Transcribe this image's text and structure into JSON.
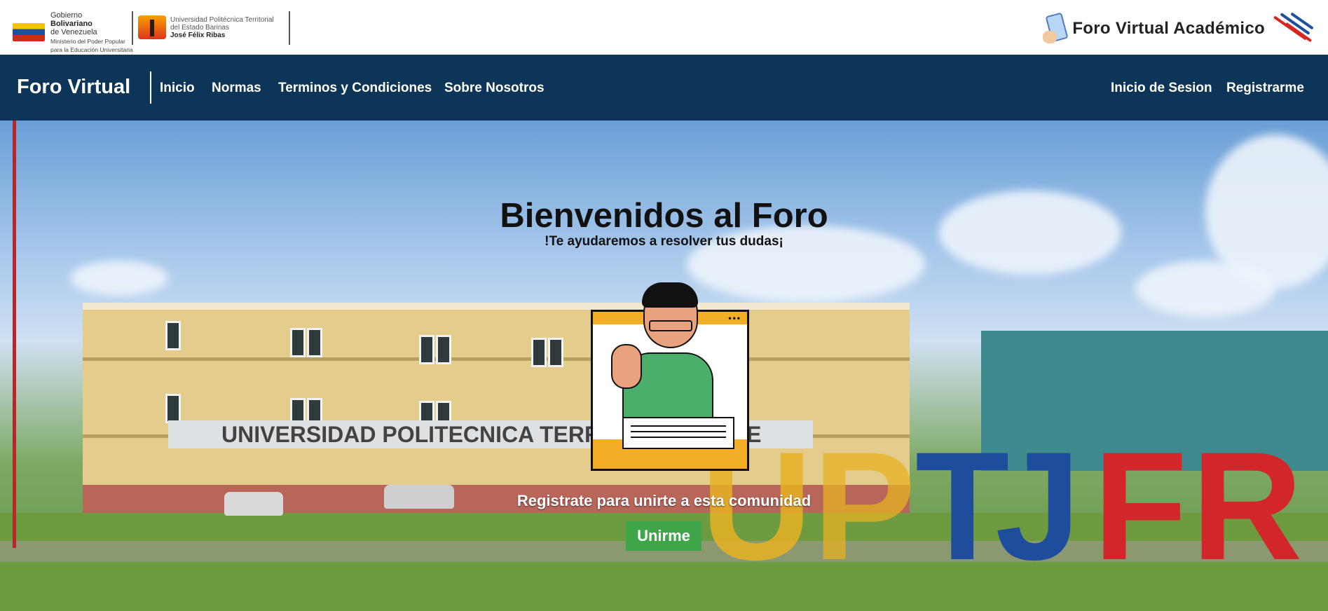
{
  "header": {
    "gov_logo": {
      "line1": "Gobierno",
      "line2": "Bolivariano",
      "line3": "de Venezuela",
      "sub1": "Ministerio del Poder Popular",
      "sub2": "para la Educación Universitaria"
    },
    "upt_logo": {
      "line1": "Universidad Politécnica Territorial",
      "line2": "del Estado Barinas",
      "line3": "José Félix Ribas"
    },
    "brand_title": "Foro Virtual Académico"
  },
  "navbar": {
    "brand": "Foro Virtual",
    "links": [
      "Inicio",
      "Normas",
      "Terminos y Condiciones",
      "Sobre Nosotros"
    ],
    "right_links": [
      "Inicio de Sesion",
      "Registrarme"
    ]
  },
  "hero": {
    "title": "Bienvenidos al Foro",
    "subtitle": "!Te ayudaremos a resolver tus dudas¡",
    "cta_text": "Registrate para unirte a esta comunidad",
    "cta_button": "Unirme",
    "banner_text": "UNIVERSIDAD POLITECNICA TERRITORIAL DEL E",
    "letters": [
      "U",
      "P",
      "T",
      "J",
      "F",
      "R"
    ]
  },
  "colors": {
    "navbar_bg": "#0c3558",
    "cta_green": "#3fa548",
    "text_white": "#ffffff"
  }
}
